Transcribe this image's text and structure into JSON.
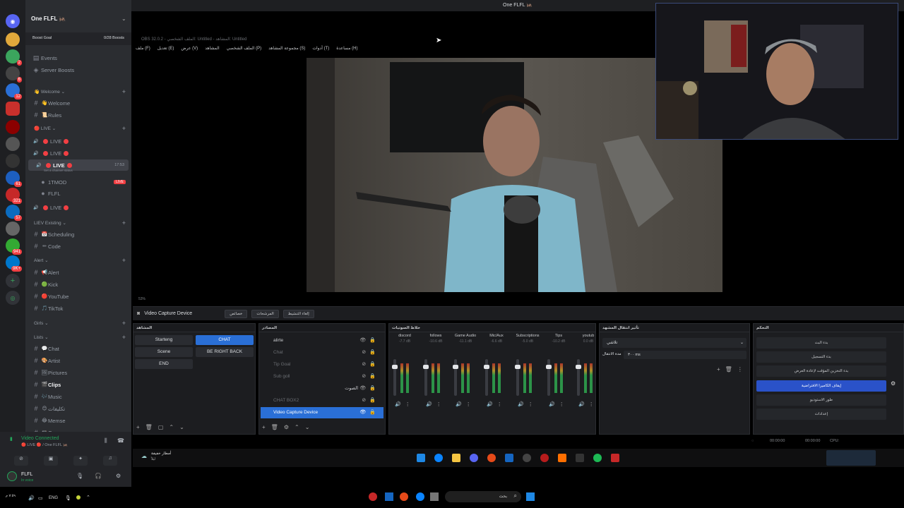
{
  "discord": {
    "server_name": "One FLFL 🦗",
    "boost_goal_label": "Boost Goal",
    "boost_goal_count": "0/28 Boosts",
    "items": [
      {
        "type": "link",
        "icon": "calendar-icon",
        "label": "Events"
      },
      {
        "type": "link",
        "icon": "boost-icon",
        "label": "Server Boosts"
      }
    ],
    "channels": [
      {
        "kind": "category",
        "label": "👋 Welcome ⌄"
      },
      {
        "kind": "text",
        "emoji": "👋",
        "label": "Welcome"
      },
      {
        "kind": "text",
        "emoji": "📜",
        "label": "Rules"
      },
      {
        "kind": "category",
        "label": "🔴 LIVE ⌄"
      },
      {
        "kind": "voice",
        "label": "LIVE"
      },
      {
        "kind": "voice",
        "label": "LIVE"
      },
      {
        "kind": "voice",
        "label": "LIVE",
        "active": true,
        "time": "17:53",
        "sub": "Set a channel status"
      },
      {
        "kind": "member",
        "label": "1TMOD",
        "live": "LIVE"
      },
      {
        "kind": "member",
        "label": "FLFL"
      },
      {
        "kind": "voice",
        "label": "LIVE"
      },
      {
        "kind": "category",
        "label": "LIEV Existing ⌄"
      },
      {
        "kind": "text",
        "emoji": "📅",
        "label": "Scheduling"
      },
      {
        "kind": "text",
        "emoji": "✏",
        "label": "Code"
      },
      {
        "kind": "category",
        "label": "Alert ⌄"
      },
      {
        "kind": "text",
        "emoji": "📢",
        "label": "Alert"
      },
      {
        "kind": "text",
        "emoji": "🟢",
        "label": "Kick"
      },
      {
        "kind": "text",
        "emoji": "🔴",
        "label": "YouTube"
      },
      {
        "kind": "text",
        "emoji": "🎵",
        "label": "TikTok"
      },
      {
        "kind": "category",
        "label": "Girls ⌄"
      },
      {
        "kind": "category",
        "label": "Lists ⌄"
      },
      {
        "kind": "text",
        "emoji": "💬",
        "label": "Chat"
      },
      {
        "kind": "text",
        "emoji": "🎨",
        "label": "Artist"
      },
      {
        "kind": "text",
        "emoji": "🖼",
        "label": "Pictures"
      },
      {
        "kind": "text",
        "emoji": "🎬",
        "label": "Clips",
        "bold": true
      },
      {
        "kind": "text",
        "emoji": "🎶",
        "label": "Music"
      },
      {
        "kind": "text",
        "emoji": "😊",
        "label": "تكليفات"
      },
      {
        "kind": "text",
        "emoji": "😂",
        "label": "Memse"
      },
      {
        "kind": "text",
        "emoji": "🎮",
        "label": "Games"
      }
    ],
    "voice_connected": "Video Connected",
    "voice_location": "🔴 LIVE 🔴 / One FLFL 🦗",
    "user_name": "FLFL",
    "user_status": "In voice",
    "rail_badges": [
      "2",
      "6",
      "12",
      "61",
      "57",
      "321",
      "941",
      "9K+"
    ]
  },
  "window_title": "One FLFL 🦗",
  "obs": {
    "title": "OBS 32.0.2 - الملف الشخصي: Untitled - المشاهد: Untitled",
    "menu": [
      "ملف (F)",
      "تعديل (E)",
      "عرض (V)",
      "المشاهد",
      "الملف الشخصي (P)",
      "مجموعة المشاهد (S)",
      "أدوات (T)",
      "مساعدة (H)"
    ],
    "zoom": "53%",
    "source_bar_label": "Video Capture Device",
    "source_bar_buttons": [
      "خصائص",
      "المرشحات",
      "إلغاء التنشيط"
    ],
    "scenes_title": "المشاهد",
    "scenes": [
      "Starteng",
      "CHAT",
      "Scene",
      "BE RIGHT BACK",
      "END"
    ],
    "selected_scene": "CHAT",
    "sources_title": "المصادر",
    "sources": [
      {
        "label": "alirte",
        "dim": false,
        "folder": true
      },
      {
        "label": "Chat",
        "dim": true
      },
      {
        "label": "Tip Goal",
        "dim": true
      },
      {
        "label": "Sub goll",
        "dim": true
      },
      {
        "label": "الصوت",
        "dim": false,
        "folder": true
      },
      {
        "label": "CHAT BOX2",
        "dim": true
      },
      {
        "label": "Video Capture Device",
        "dim": false,
        "selected": true
      }
    ],
    "mixer_title": "خلاط الصوتيات",
    "mixer": [
      {
        "name": "discord",
        "db": "-7.7 dB"
      },
      {
        "name": "follows",
        "db": "-10.6 dB"
      },
      {
        "name": "Game Audio",
        "db": "-11.1 dB"
      },
      {
        "name": "Mic/Aux",
        "db": "-6.6 dB"
      },
      {
        "name": "Subscriptions",
        "db": "-5.0 dB"
      },
      {
        "name": "Tips",
        "db": "-10.2 dB"
      },
      {
        "name": "youtub",
        "db": "0.0 dB"
      }
    ],
    "transition_title": "تأثير انتقال المشهد",
    "transition_value": "تلاشي",
    "transition_duration_label": "مدة الانتقال",
    "transition_duration": "٣٠٠ ms",
    "controls_title": "التحكم",
    "controls": [
      "بدء البث",
      "بدء التسجيل",
      "بدء التخزين المؤقت لإعادة العرض",
      "إيقاف الكاميرا الافتراضية",
      "طور الاستوديو",
      "إعدادات"
    ],
    "selected_control": "إيقاف الكاميرا الافتراضية",
    "status_time1": "00:00:00",
    "status_time2": "00:00:00",
    "status_cpu": "CPU:"
  },
  "taskbar": {
    "weather": "أمطار خفيفة",
    "weather_sub": "ليلاً",
    "lang": "ENG",
    "clock": "٧:٥٩ م",
    "search_placeholder": "بحث"
  }
}
